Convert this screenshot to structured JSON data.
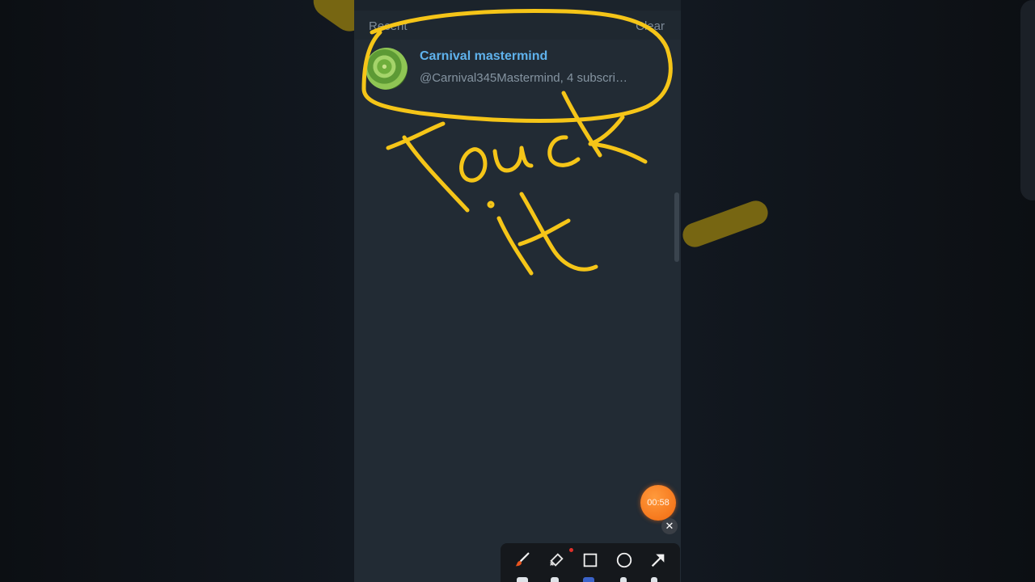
{
  "screen": {
    "recent_label": "Recent",
    "clear_label": "Clear"
  },
  "result": {
    "title": "Carnival mastermind",
    "subtitle": "@Carnival345Mastermind, 4 subscri…"
  },
  "recording": {
    "timer": "00:58",
    "close_glyph": "✕"
  },
  "toolbar": {
    "tools": [
      "brush-icon",
      "eraser-icon",
      "rectangle-icon",
      "circle-icon",
      "arrow-icon"
    ]
  },
  "annotation": {
    "handwritten_text": "Touch it",
    "color": "#f5c518"
  },
  "colors": {
    "accent_title": "#5fb2ec",
    "panel_bg": "#222b34",
    "timer_orange": "#f26a10"
  }
}
